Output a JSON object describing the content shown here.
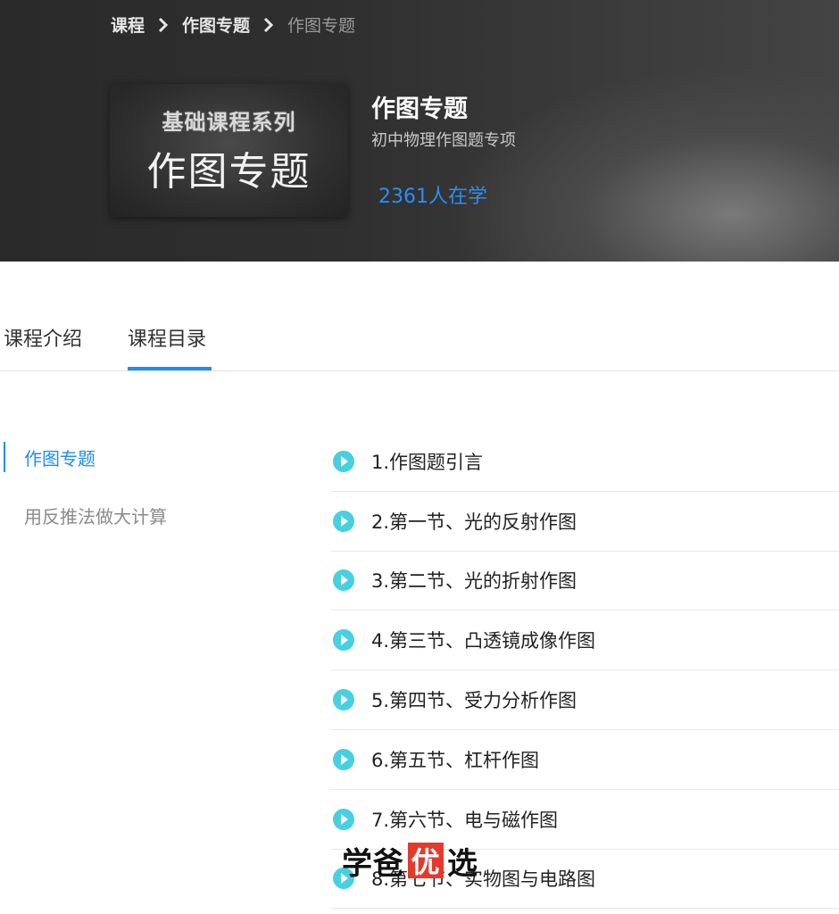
{
  "breadcrumb": {
    "items": [
      "课程",
      "作图专题",
      "作图专题"
    ]
  },
  "cover": {
    "subtitle": "基础课程系列",
    "title": "作图专题"
  },
  "course": {
    "title": "作图专题",
    "subtitle": "初中物理作图题专项",
    "learners": "2361人在学"
  },
  "tabs": {
    "intro": "课程介绍",
    "catalog": "课程目录",
    "active": "catalog"
  },
  "sidebar": {
    "items": [
      {
        "label": "作图专题",
        "active": true
      },
      {
        "label": "用反推法做大计算",
        "active": false
      }
    ]
  },
  "lessons": [
    {
      "label": "1.作图题引言"
    },
    {
      "label": "2.第一节、光的反射作图"
    },
    {
      "label": "3.第二节、光的折射作图"
    },
    {
      "label": "4.第三节、凸透镜成像作图"
    },
    {
      "label": "5.第四节、受力分析作图"
    },
    {
      "label": "6.第五节、杠杆作图"
    },
    {
      "label": "7.第六节、电与磁作图"
    },
    {
      "label": "8.第七节、实物图与电路图"
    }
  ],
  "watermark": {
    "part1": "学爸",
    "highlight": "优",
    "part2": "选"
  },
  "colors": {
    "accent": "#1e8ef2",
    "play": "#47d0e0",
    "watermark_red": "#e33a2c"
  },
  "icons": {
    "breadcrumb_separator": "chevron-right-icon",
    "lesson": "play-circle-icon"
  }
}
